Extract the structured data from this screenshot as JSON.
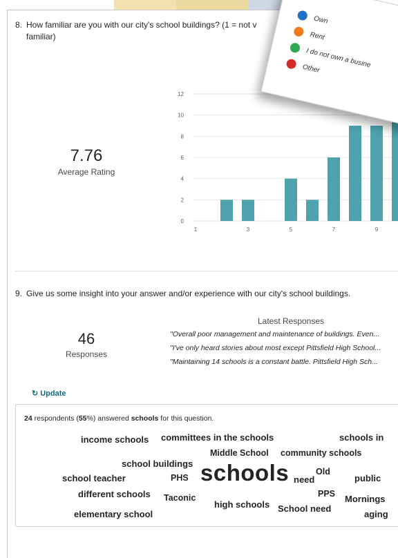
{
  "question8": {
    "number": "8.",
    "text": "How familiar are you with our city's school buildings? (1 = not v",
    "text_cont": "familiar)",
    "average_value": "7.76",
    "average_label": "Average Rating"
  },
  "chart_data": {
    "type": "bar",
    "categories": [
      "1",
      "2",
      "3",
      "4",
      "5",
      "6",
      "7",
      "8",
      "9",
      "10"
    ],
    "x_tick_labels": [
      "1",
      "3",
      "5",
      "7",
      "9"
    ],
    "values": [
      0,
      2,
      2,
      0,
      4,
      2,
      6,
      9,
      9,
      10
    ],
    "ylim": [
      0,
      12
    ],
    "y_ticks": [
      "0",
      "2",
      "4",
      "6",
      "8",
      "10",
      "12"
    ],
    "grid": true,
    "bar_color": "#4da2ad"
  },
  "question9": {
    "number": "9.",
    "text": "Give us some insight into your answer and/or experience with our city's school buildings.",
    "responses_count": "46",
    "responses_label": "Responses",
    "latest_heading": "Latest Responses",
    "latest": [
      "\"Overall poor management and maintenance of buildings. Even...",
      "\"I've only heard stories about most except Pittsfield High School...",
      "\"Maintaining 14 schools is a constant battle. Pittsfield High Sch..."
    ],
    "update_label": "Update"
  },
  "word_cloud": {
    "summary_count": "24",
    "summary_mid": " respondents (",
    "summary_pct": "55",
    "summary_mid2": "%) answered ",
    "summary_word": "schools",
    "summary_end": " for this question.",
    "words": [
      {
        "text": "income schools",
        "color": "#0b6a74"
      },
      {
        "text": "committees in the schools",
        "color": "#0b6a74"
      },
      {
        "text": "schools in",
        "color": "#2a9aa6"
      },
      {
        "text": "Middle School",
        "color": "#0b6a74"
      },
      {
        "text": "community schools",
        "color": "#1f2a30"
      },
      {
        "text": "school buildings",
        "color": "#0b6a74"
      },
      {
        "text": "school teacher",
        "color": "#2a9aa6"
      },
      {
        "text": "PHS",
        "color": "#1f2a30"
      },
      {
        "text": "schools",
        "color": "#0b6a74"
      },
      {
        "text": "need",
        "color": "#2a9aa6"
      },
      {
        "text": "Old",
        "color": "#1f2a30"
      },
      {
        "text": "public",
        "color": "#1f2a30"
      },
      {
        "text": "different schools",
        "color": "#2a9aa6"
      },
      {
        "text": "Taconic",
        "color": "#0b6a74"
      },
      {
        "text": "PPS",
        "color": "#1f2a30"
      },
      {
        "text": "high schools",
        "color": "#2a9aa6"
      },
      {
        "text": "School need",
        "color": "#0b6a74"
      },
      {
        "text": "Mornings",
        "color": "#2a9aa6"
      },
      {
        "text": "elementary school",
        "color": "#0b6a74"
      },
      {
        "text": "aging",
        "color": "#1f2a30"
      }
    ]
  },
  "popup_legend": [
    {
      "label": "Own",
      "color": "#1f6fc5"
    },
    {
      "label": "Rent",
      "color": "#f07a1a"
    },
    {
      "label": "I do not own a busine",
      "color": "#2fa84f"
    },
    {
      "label": "Other",
      "color": "#d62b2b"
    }
  ]
}
